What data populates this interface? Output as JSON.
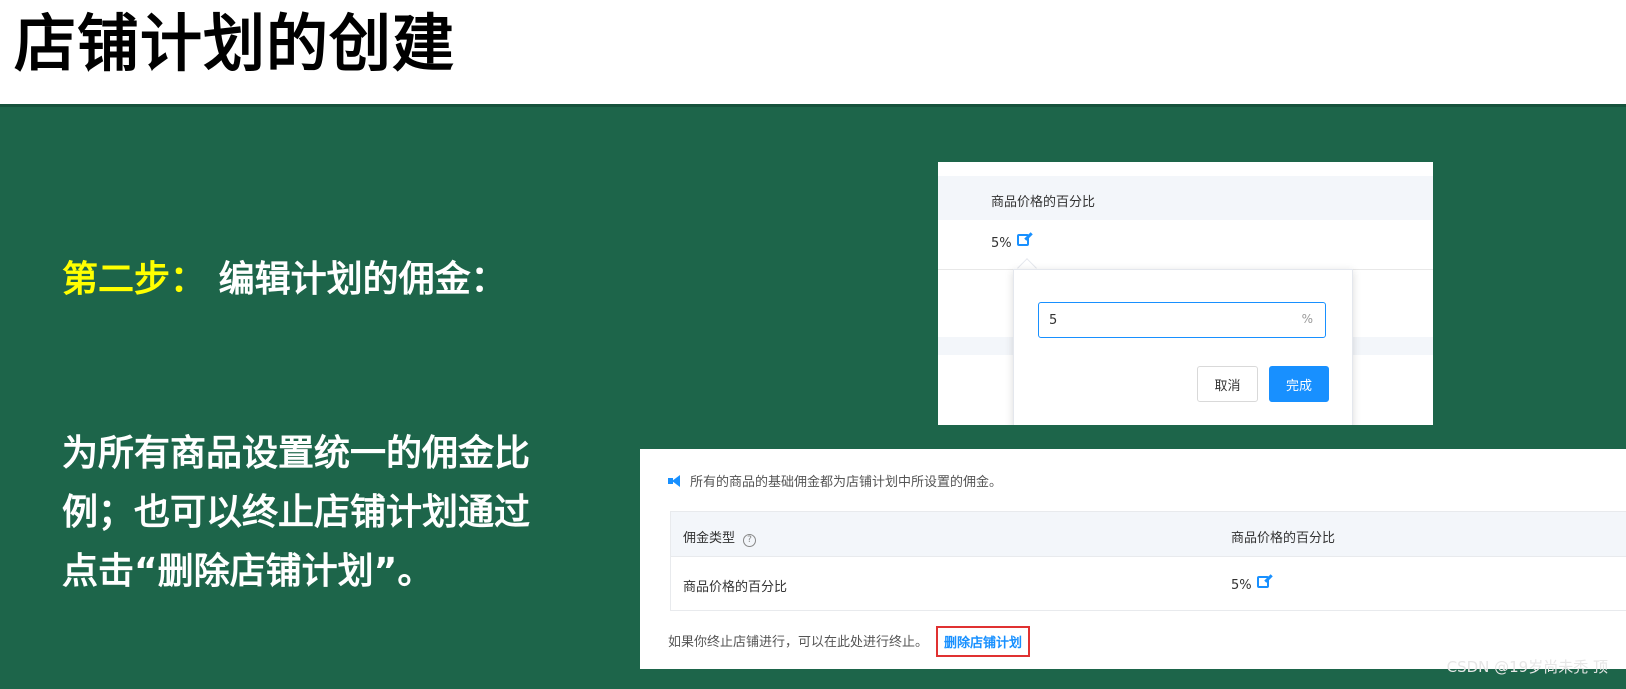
{
  "slide": {
    "title": "店铺计划的创建",
    "step_label": "第二步：",
    "step_text": "编辑计划的佣金：",
    "description": "为所有商品设置统一的佣金比例；也可以终止店铺计划通过点击“删除店铺计划”。"
  },
  "panel_edit": {
    "column_header": "商品价格的百分比",
    "current_value": "5%",
    "input_value": "5",
    "input_suffix": "%",
    "cancel_label": "取消",
    "confirm_label": "完成"
  },
  "panel_settings": {
    "notice": "所有的商品的基础佣金都为店铺计划中所设置的佣金。",
    "table": {
      "headers": [
        "佣金类型",
        "商品价格的百分比"
      ],
      "rows": [
        [
          "商品价格的百分比",
          "5%"
        ]
      ]
    },
    "footer_text": "如果你终止店铺进行，可以在此处进行终止。",
    "delete_link": "删除店铺计划"
  },
  "watermark": "CSDN @19岁尚未秃 顶",
  "colors": {
    "background_green": "#1d654a",
    "highlight_yellow": "#ffff00",
    "accent_blue": "#1890ff",
    "highlight_box_red": "#e03131"
  },
  "icons": {
    "edit": "edit-icon",
    "speaker": "speaker-icon",
    "help": "help-icon"
  }
}
